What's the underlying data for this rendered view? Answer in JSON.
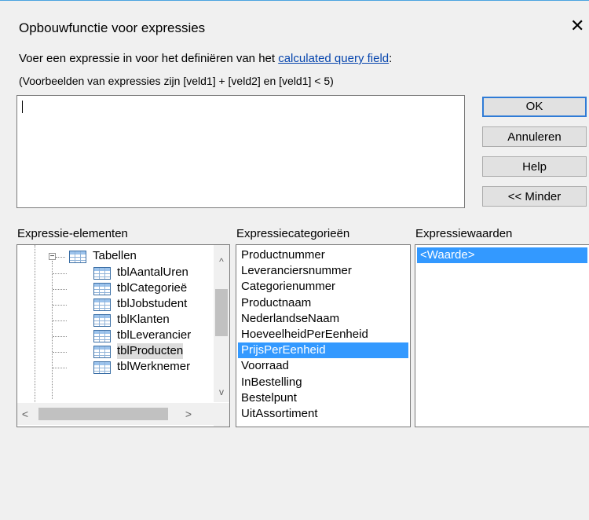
{
  "dialog": {
    "title": "Opbouwfunctie voor expressies",
    "close_symbol": "✕"
  },
  "instructions": {
    "prefix": "Voer een expressie in voor het definiëren van het ",
    "link": "calculated query field",
    "suffix": ":",
    "example": "(Voorbeelden van expressies zijn [veld1] + [veld2] en [veld1] < 5)"
  },
  "expression_input": {
    "value": ""
  },
  "buttons": {
    "ok": "OK",
    "cancel": "Annuleren",
    "help": "Help",
    "less": "<< Minder"
  },
  "panels": {
    "elements_label": "Expressie-elementen",
    "categories_label": "Expressiecategorieën",
    "values_label": "Expressiewaarden"
  },
  "tree": {
    "root": {
      "label": "Tabellen",
      "expander": "−"
    },
    "items": [
      "tblAantalUren",
      "tblCategorieë",
      "tblJobstudent",
      "tblKlanten",
      "tblLeverancier",
      "tblProducten",
      "tblWerknemer"
    ],
    "selected": "tblProducten",
    "scroll_up": "^",
    "scroll_down": "v",
    "scroll_left": "<",
    "scroll_right": ">"
  },
  "categories": {
    "items": [
      "Productnummer",
      "Leveranciersnummer",
      "Categorienummer",
      "Productnaam",
      "NederlandseNaam",
      "HoeveelheidPerEenheid",
      "PrijsPerEenheid",
      "Voorraad",
      "InBestelling",
      "Bestelpunt",
      "UitAssortiment"
    ],
    "selected": "PrijsPerEenheid"
  },
  "values": {
    "items": [
      "<Waarde>"
    ],
    "selected": "<Waarde>"
  },
  "colors": {
    "accent": "#2f7bd6",
    "selection": "#3399ff",
    "link": "#0645ad"
  }
}
